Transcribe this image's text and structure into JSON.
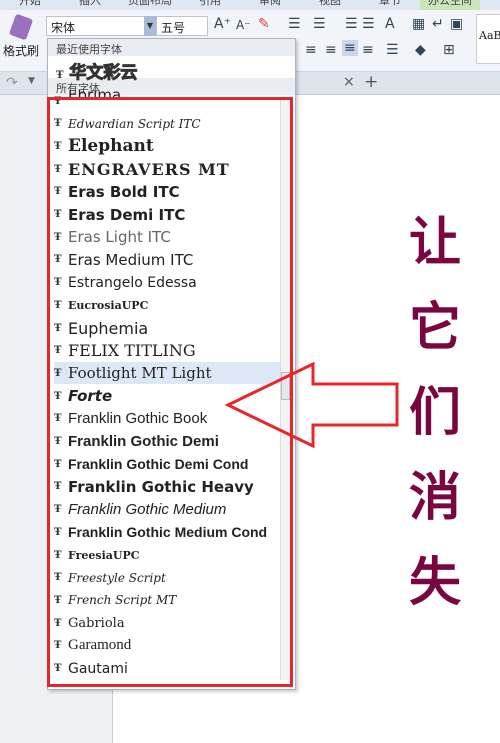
{
  "ribbon_tabs": [
    "开始",
    "插入",
    "页面布局",
    "引用",
    "审阅",
    "视图",
    "章节",
    "办公空间"
  ],
  "toolbar": {
    "format_painter": "格式刷",
    "font_name": "宋体",
    "font_size": "五号",
    "style_preview": "AaB",
    "close_tab": "×",
    "new_tab": "+"
  },
  "dropdown": {
    "recent_header": "最近使用字体",
    "recent_font": "华文彩云",
    "all_header": "所有字体",
    "fonts": [
      "Ebrima",
      "Edwardian Script ITC",
      "Elephant",
      "ENGRAVERS MT",
      "Eras Bold ITC",
      "Eras Demi ITC",
      "Eras Light ITC",
      "Eras Medium ITC",
      "Estrangelo Edessa",
      "EucrosiaUPC",
      "Euphemia",
      "FELIX TITLING",
      "Footlight MT Light",
      "Forte",
      "Franklin Gothic Book",
      "Franklin Gothic Demi",
      "Franklin Gothic Demi Cond",
      "Franklin Gothic Heavy",
      "Franklin Gothic Medium",
      "Franklin Gothic Medium Cond",
      "FreesiaUPC",
      "Freestyle Script",
      "French Script MT",
      "Gabriola",
      "Garamond",
      "Gautami"
    ],
    "selected": "Footlight MT Light"
  },
  "annotation": {
    "text": [
      "让",
      "它",
      "们",
      "消",
      "失"
    ],
    "text_color": "#7a0640",
    "highlight_color": "#e8262a"
  }
}
